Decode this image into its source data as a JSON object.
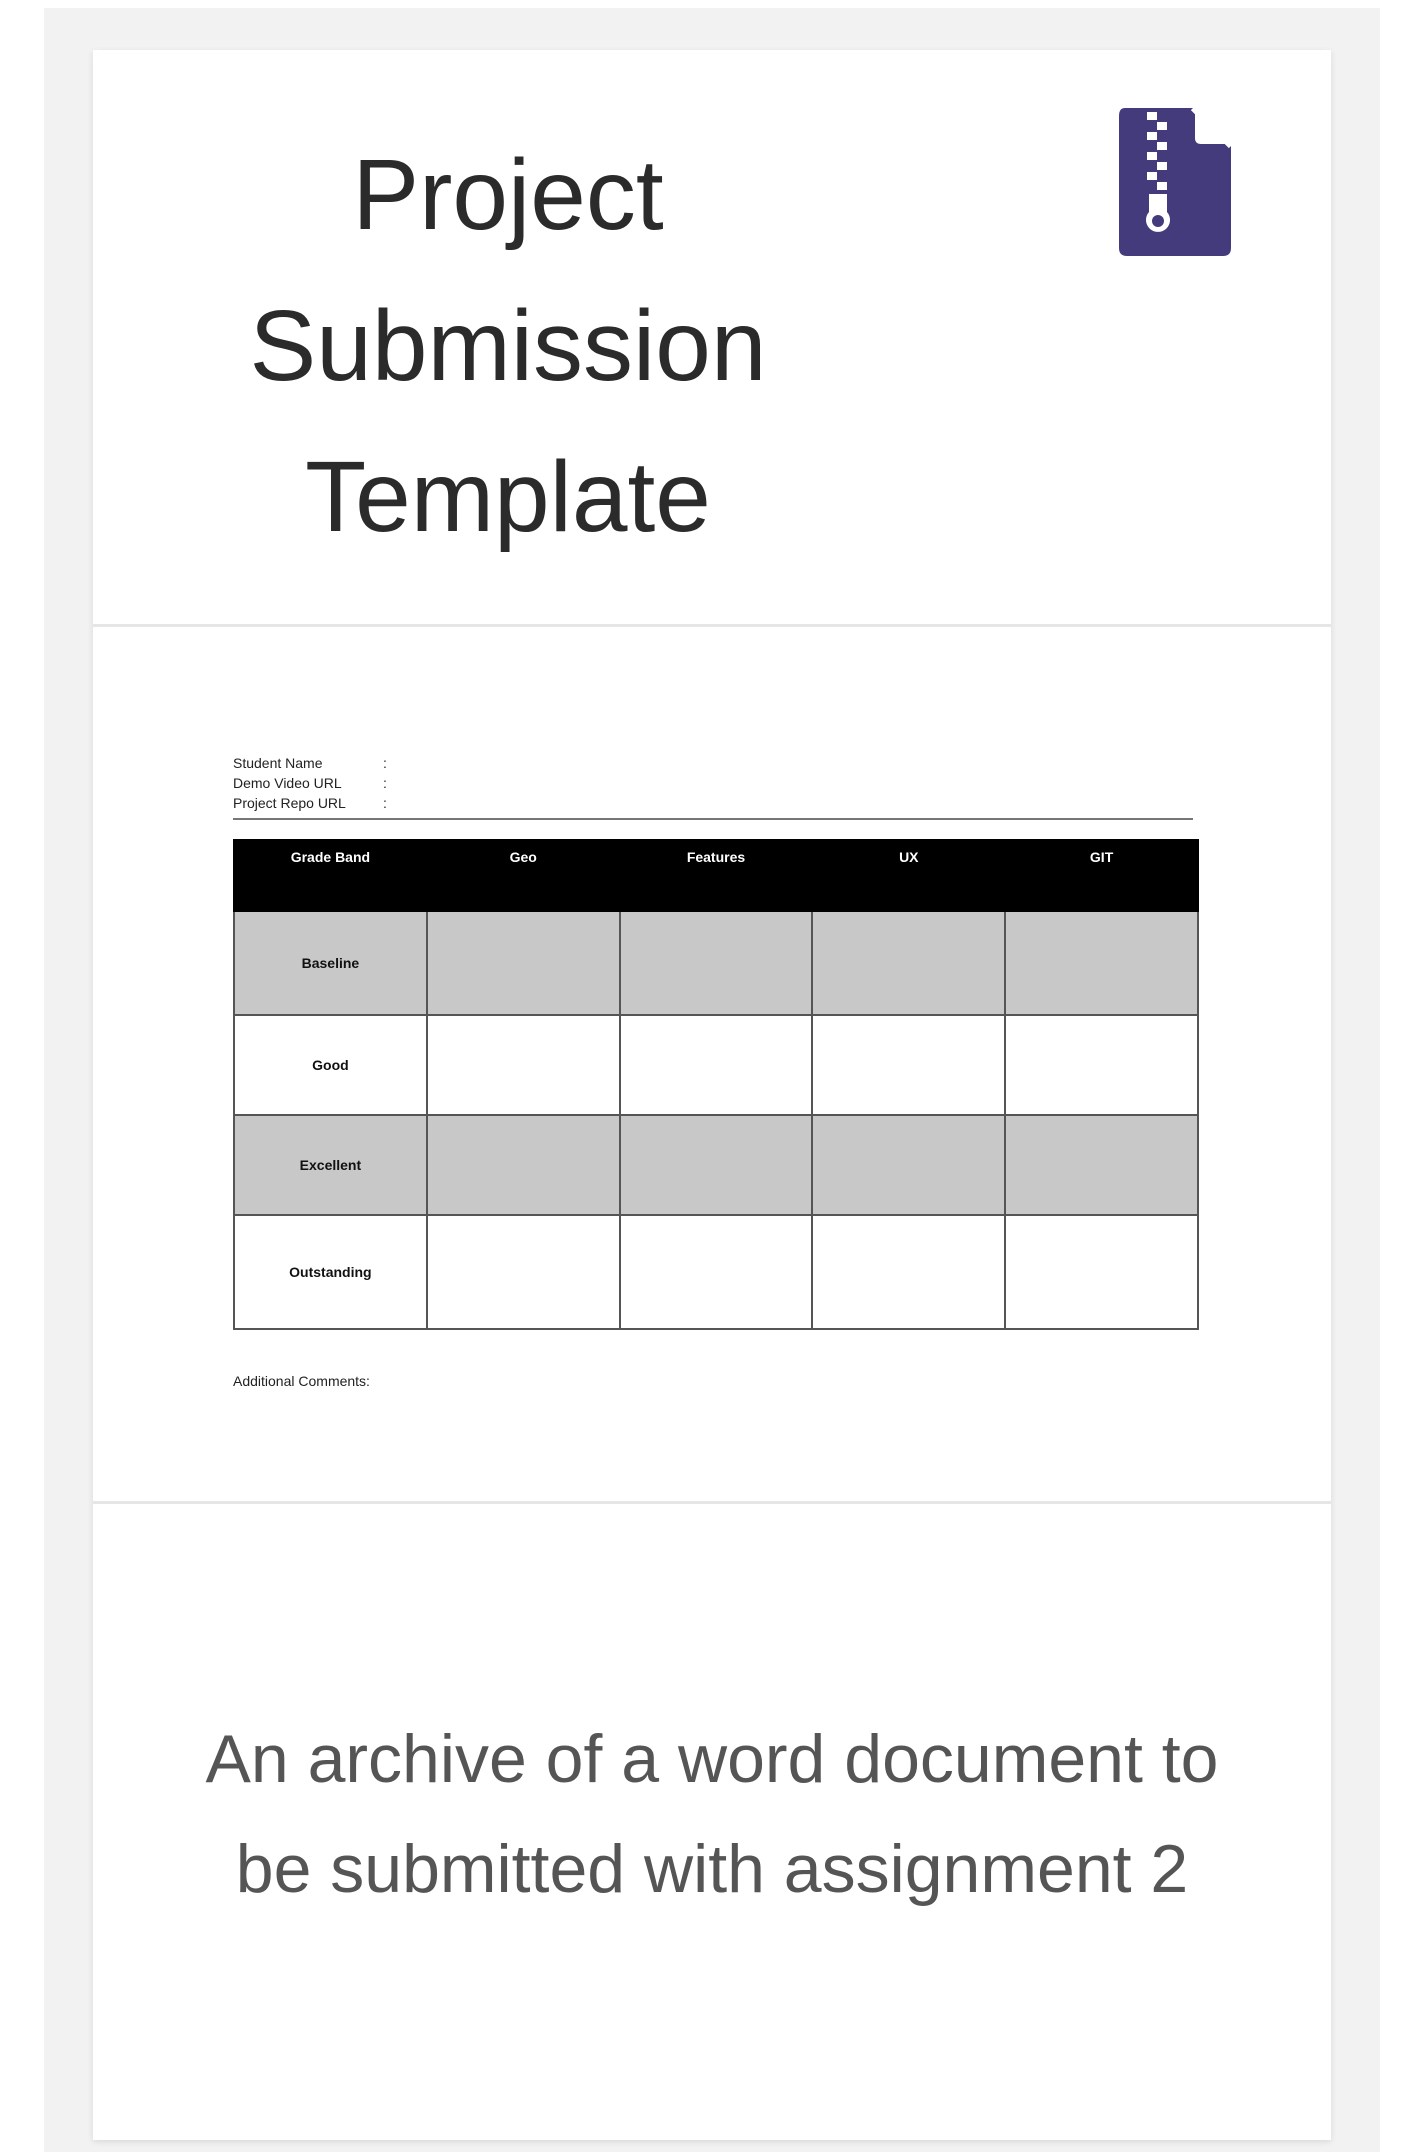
{
  "card": {
    "title": "Project Submission Template",
    "file_icon": "zip-file-icon",
    "accent_color": "#433b7c",
    "description": "An archive of a word document to be submitted with assignment 2"
  },
  "preview": {
    "fields": [
      {
        "label": "Student Name",
        "sep": ":"
      },
      {
        "label": "Demo Video URL",
        "sep": ":"
      },
      {
        "label": "Project Repo URL",
        "sep": ":"
      }
    ],
    "table": {
      "headers": [
        "Grade Band",
        "Geo",
        "Features",
        "UX",
        "GIT"
      ],
      "rows": [
        "Baseline",
        "Good",
        "Excellent",
        "Outstanding"
      ]
    },
    "comments_label": "Additional Comments:"
  }
}
